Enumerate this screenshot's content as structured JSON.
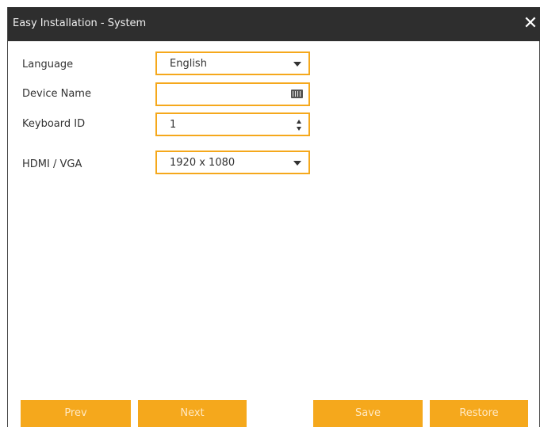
{
  "dialog": {
    "title": "Easy Installation - System",
    "close_label": "✕"
  },
  "form": {
    "language": {
      "label": "Language",
      "value": "English"
    },
    "device_name": {
      "label": "Device Name",
      "value": ""
    },
    "keyboard_id": {
      "label": "Keyboard ID",
      "value": "1"
    },
    "hdmi_vga": {
      "label": "HDMI / VGA",
      "value": "1920 x 1080"
    }
  },
  "buttons": {
    "prev": "Prev",
    "next": "Next",
    "save": "Save",
    "restore": "Restore"
  },
  "colors": {
    "accent": "#f5a81c",
    "titlebar": "#2e2e2e"
  }
}
